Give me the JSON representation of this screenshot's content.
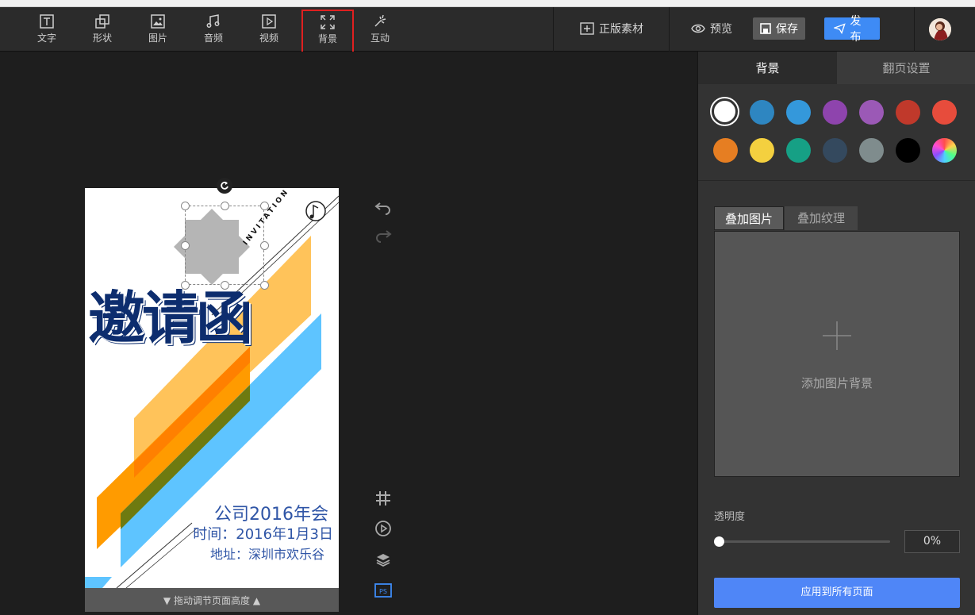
{
  "toolbar": {
    "tools": [
      {
        "label": "文字",
        "icon": "text-icon"
      },
      {
        "label": "形状",
        "icon": "shape-icon"
      },
      {
        "label": "图片",
        "icon": "image-icon"
      },
      {
        "label": "音频",
        "icon": "music-icon"
      },
      {
        "label": "视频",
        "icon": "video-icon"
      },
      {
        "label": "背景",
        "icon": "background-icon",
        "active": true
      },
      {
        "label": "互动",
        "icon": "interaction-icon"
      }
    ],
    "material_label": "正版素材",
    "preview_label": "预览",
    "save_label": "保存",
    "publish_label": "发布"
  },
  "card": {
    "side_text": "INVITATION",
    "title": "邀请函",
    "line1": "公司2016年会",
    "line2": "时间：2016年1月3日",
    "line3": "地址：深圳市欢乐谷"
  },
  "canvas": {
    "drag_label": "拖动调节页面高度",
    "side_tools": [
      "undo-icon",
      "redo-icon",
      "grid-icon",
      "play-icon",
      "layers-icon",
      "ps-icon"
    ]
  },
  "panel": {
    "tab_background": "背景",
    "tab_page_turn": "翻页设置",
    "swatches": [
      "#ffffff",
      "#2e86c1",
      "#3498db",
      "#8e44ad",
      "#9b59b6",
      "#c0392b",
      "#e74c3c",
      "#e67e22",
      "#f4d03f",
      "#16a085",
      "#34495e",
      "#7f8c8d",
      "#000000"
    ],
    "selected_swatch": "#ffffff",
    "subtab_image": "叠加图片",
    "subtab_texture": "叠加纹理",
    "add_bg_label": "添加图片背景",
    "opacity_label": "透明度",
    "opacity_value": "0%",
    "apply_label": "应用到所有页面"
  },
  "colors": {
    "accent": "#4f86f7",
    "publish": "#3e8bf5",
    "active_border": "#e02020",
    "title_blue": "#0d2d6e",
    "orange": "#ff9b00",
    "light_orange": "#ffc35a",
    "sky_blue": "#5ec4ff"
  }
}
